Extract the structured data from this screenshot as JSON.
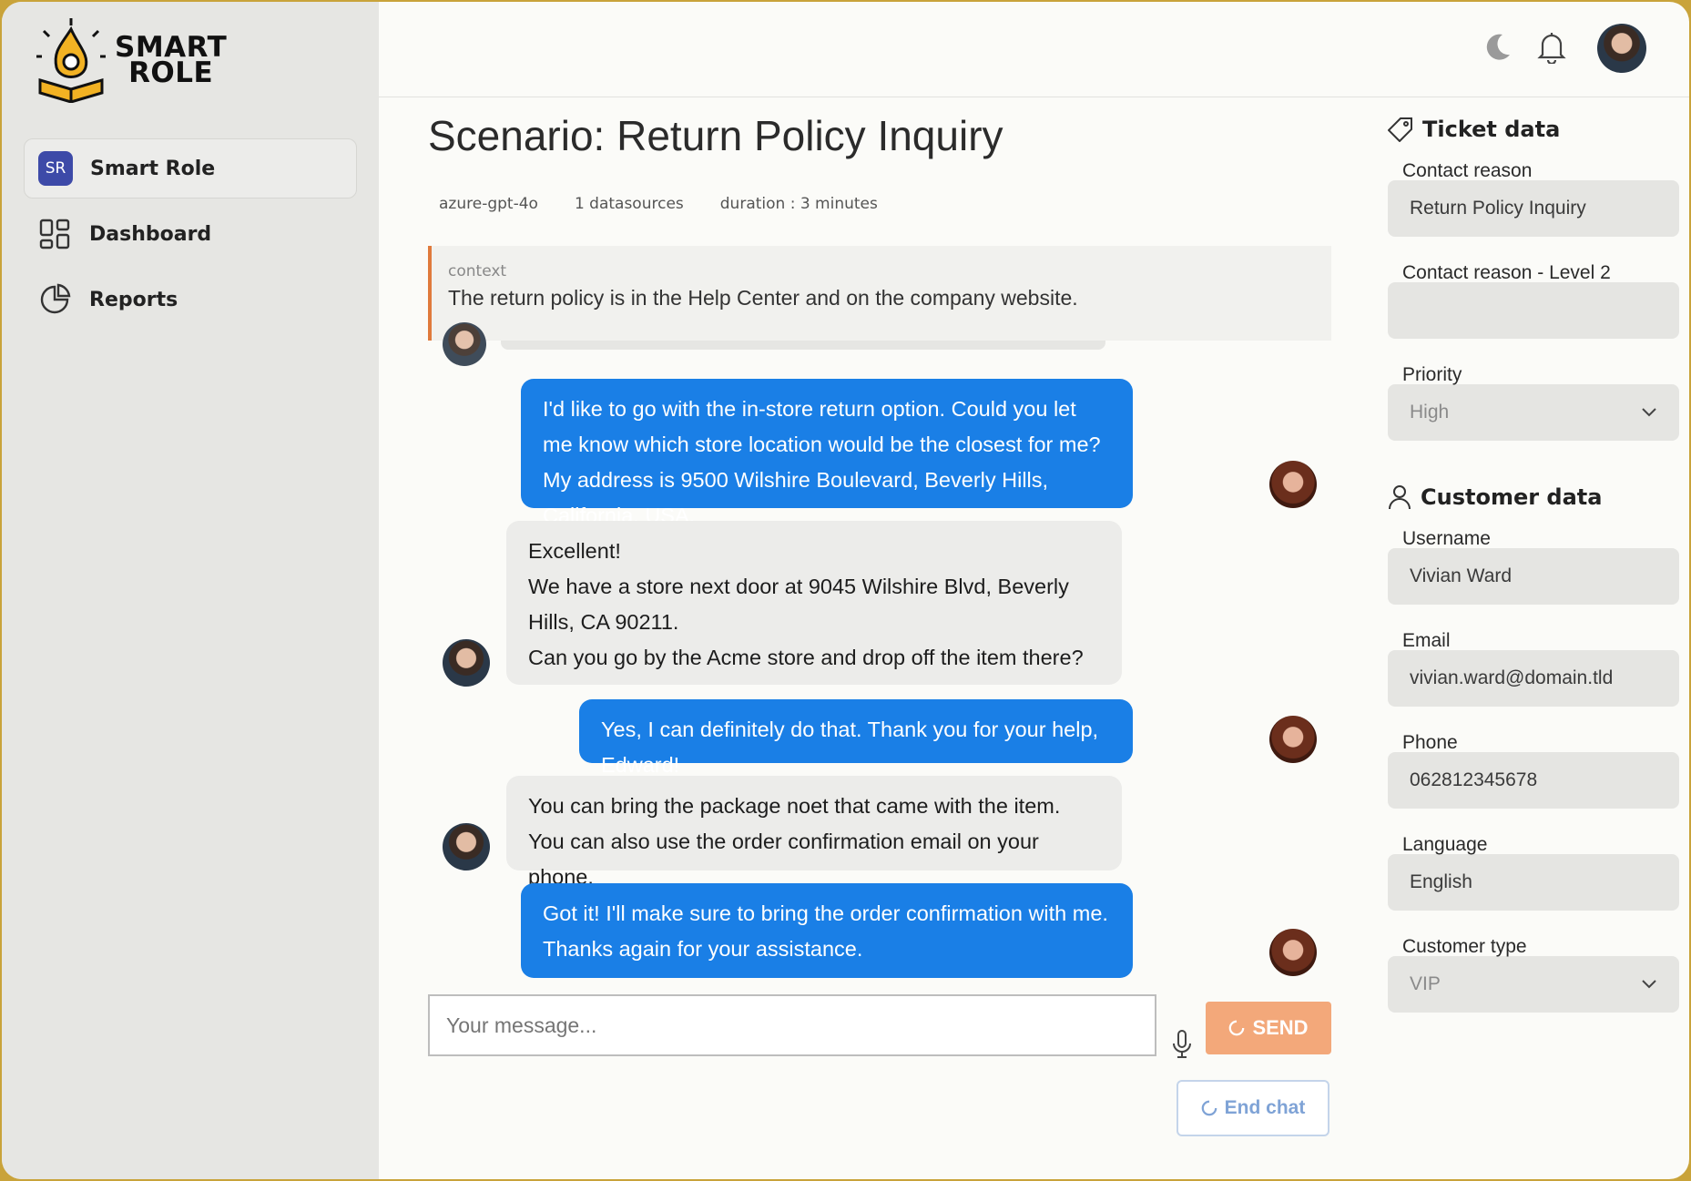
{
  "brand": {
    "logo_line1": "SMART",
    "logo_line2": "ROLE"
  },
  "sidebar": {
    "items": [
      {
        "label": "Smart Role",
        "badge": "SR",
        "active": true
      },
      {
        "label": "Dashboard",
        "icon": "dashboard-grid-icon"
      },
      {
        "label": "Reports",
        "icon": "pie-chart-icon"
      }
    ]
  },
  "topbar": {
    "icons": [
      "moon-icon",
      "bell-icon",
      "user-avatar"
    ]
  },
  "scenario": {
    "title": "Scenario: Return Policy Inquiry",
    "model": "azure-gpt-4o",
    "datasources": "1 datasources",
    "duration": "duration : 3 minutes",
    "context_label": "context",
    "context_text": "The return policy is in the Help Center and on the company website."
  },
  "messages": [
    {
      "role": "user",
      "text": "I'd like to go with the in-store return option. Could you let me know which store location would be the closest for me? My address is 9500 Wilshire Boulevard, Beverly Hills, California, USA."
    },
    {
      "role": "bot",
      "line1": "Excellent!",
      "line2": "We have a store next door at 9045 Wilshire Blvd, Beverly Hills, CA 90211.",
      "line3": "Can you go by the Acme store and drop off the item there?"
    },
    {
      "role": "user",
      "text": "Yes, I can definitely do that. Thank you for your help, Edward!"
    },
    {
      "role": "bot",
      "text": "You can bring the package noet that came with the item. You can also use the order confirmation email on your phone."
    },
    {
      "role": "user",
      "text": "Got it! I'll make sure to bring the order confirmation with me. Thanks again for your assistance."
    }
  ],
  "composer": {
    "placeholder": "Your message...",
    "send_label": "SEND",
    "end_label": "End chat"
  },
  "ticket": {
    "heading": "Ticket data",
    "contact_reason_label": "Contact reason",
    "contact_reason": "Return Policy Inquiry",
    "contact_reason_l2_label": "Contact reason - Level 2",
    "contact_reason_l2": "",
    "priority_label": "Priority",
    "priority": "High"
  },
  "customer": {
    "heading": "Customer data",
    "username_label": "Username",
    "username": "Vivian Ward",
    "email_label": "Email",
    "email": "vivian.ward@domain.tld",
    "phone_label": "Phone",
    "phone": "062812345678",
    "language_label": "Language",
    "language": "English",
    "type_label": "Customer type",
    "type": "VIP"
  },
  "colors": {
    "accent": "#1a7fe6",
    "send": "#f3a87a",
    "context_bar": "#e07a3c",
    "badge": "#3d4aa8"
  }
}
